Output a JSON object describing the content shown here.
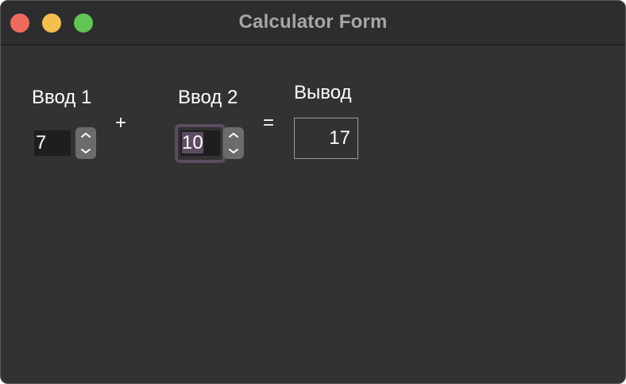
{
  "window": {
    "title": "Calculator Form"
  },
  "form": {
    "input1_label": "Ввод 1",
    "input1_value": "7",
    "plus_sign": "+",
    "input2_label": "Ввод 2",
    "input2_value": "10",
    "equals_sign": "=",
    "output_label": "Вывод",
    "output_value": "17"
  },
  "colors": {
    "window_bg": "#323232",
    "titlebar_bg": "#2d2c2f",
    "close": "#ee6a5f",
    "minimize": "#f5bf4f",
    "zoom": "#61c554",
    "focus": "#5e4a63"
  },
  "icons": {
    "stepper_up": "chevron-up-icon",
    "stepper_down": "chevron-down-icon"
  }
}
